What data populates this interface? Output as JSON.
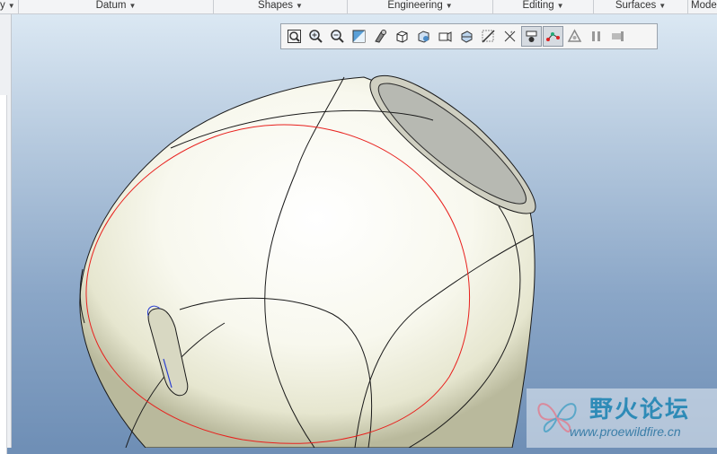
{
  "ribbon": {
    "groups": [
      {
        "label": "y"
      },
      {
        "label": "Datum"
      },
      {
        "label": "Shapes"
      },
      {
        "label": "Engineering"
      },
      {
        "label": "Editing"
      },
      {
        "label": "Surfaces"
      },
      {
        "label": "Mode"
      }
    ]
  },
  "view_toolbar": {
    "buttons": [
      {
        "icon": "refit-icon"
      },
      {
        "icon": "zoom-in-icon"
      },
      {
        "icon": "zoom-out-icon"
      },
      {
        "icon": "repaint-icon"
      },
      {
        "icon": "display-style-icon"
      },
      {
        "icon": "saved-orientations-icon"
      },
      {
        "icon": "view-manager-icon"
      },
      {
        "icon": "perspective-view-icon"
      },
      {
        "icon": "section-icon"
      },
      {
        "icon": "annotation-display-icon"
      },
      {
        "icon": "datum-display-icon"
      },
      {
        "icon": "spin-center-icon",
        "active": true
      },
      {
        "icon": "sketch-display-icon",
        "active": true
      },
      {
        "icon": "appearance-icon"
      },
      {
        "icon": "pause-icon"
      },
      {
        "icon": "resume-icon"
      }
    ]
  },
  "watermark": {
    "chinese": "野火论坛",
    "url": "www.proewildfire.cn"
  },
  "colors": {
    "viewport_top": "#dbe8f3",
    "viewport_bottom": "#6f8fb6",
    "model_fill": "#fafaf2",
    "highlight_curve": "#e8201d",
    "watermark": "#2e8bb7"
  }
}
